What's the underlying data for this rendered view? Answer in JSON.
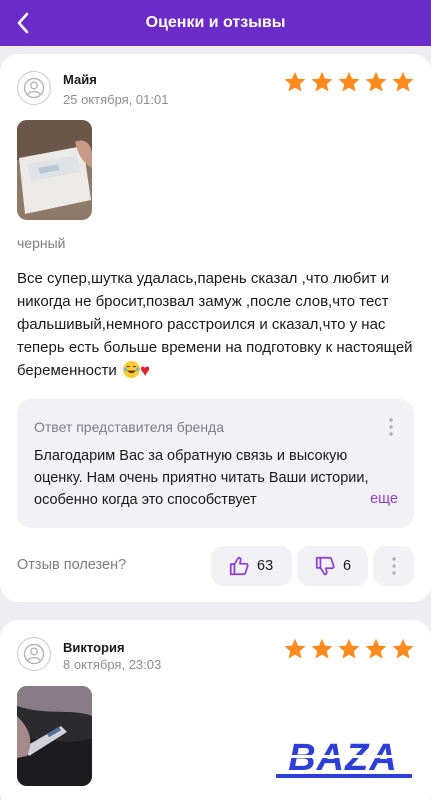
{
  "header": {
    "title": "Оценки и отзывы"
  },
  "reviews": [
    {
      "author": "Майя",
      "date": "25 октября, 01:01",
      "rating": 5,
      "variant": "черный",
      "text": "Все супер,шутка удалась,парень сказал ,что любит и никогда не бросит,позвал замуж ,после слов,что тест фальшивый,немного расстроился и сказал,что у нас теперь есть больше времени на подготовку к настоящей беременности",
      "brand_reply": {
        "title": "Ответ представителя бренда",
        "text": "Благодарим Вас за обратную связь и высокую оценку. Нам очень приятно читать Ваши истории, особенно когда это способствует",
        "more_label": "еще"
      },
      "helpful_label": "Отзыв полезен?",
      "likes": "63",
      "dislikes": "6"
    },
    {
      "author": "Виктория",
      "date": "8 октября, 23:03",
      "rating": 5
    }
  ],
  "watermark": "BAZA",
  "colors": {
    "accent": "#6b2bc9",
    "star": "#ff8a1e",
    "link": "#8b3fd6"
  }
}
